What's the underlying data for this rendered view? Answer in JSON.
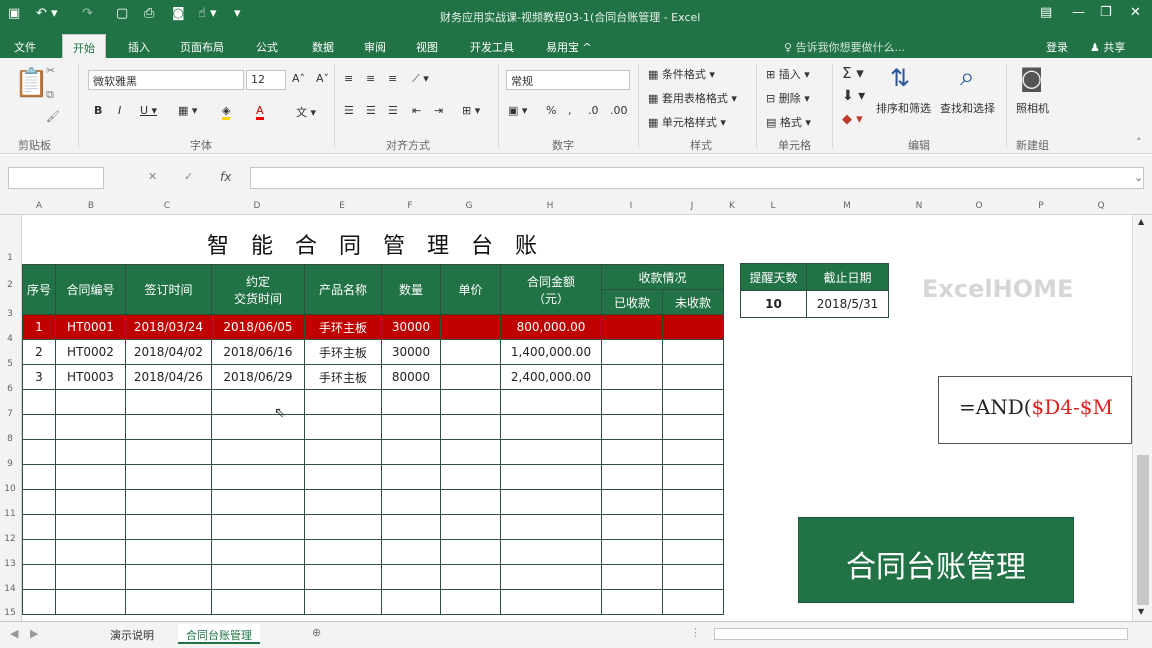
{
  "window": {
    "title": "财务应用实战课-视频教程03-1(合同台账管理 - Excel",
    "quick_access": [
      "save-icon",
      "undo-icon",
      "redo-icon",
      "new-icon",
      "print-preview-icon",
      "camera-icon",
      "touch-icon",
      "customize-icon"
    ],
    "controls": {
      "minimize": "—",
      "restore": "❐",
      "close": "✕"
    }
  },
  "ribbon": {
    "tabs": [
      "文件",
      "开始",
      "插入",
      "页面布局",
      "公式",
      "数据",
      "审阅",
      "视图",
      "开发工具",
      "易用宝 ^"
    ],
    "active_tab": "开始",
    "search_placeholder": "告诉我你想要做什么...",
    "share": "共享",
    "login": "登录",
    "font_name": "微软雅黑",
    "font_size": "12",
    "number_format": "常规",
    "buttons": {
      "cond_format": "条件格式",
      "table_format": "套用表格格式",
      "cell_style": "单元格样式",
      "insert": "插入",
      "delete": "删除",
      "format": "格式",
      "sort_filter": "排序和筛选",
      "find_select": "查找和选择",
      "camera": "照相机"
    },
    "groups": [
      "剪贴板",
      "字体",
      "对齐方式",
      "数字",
      "样式",
      "单元格",
      "编辑",
      "新建组"
    ]
  },
  "formula_bar": {
    "fx": "fx",
    "name_box": "",
    "content": ""
  },
  "columns": [
    "A",
    "B",
    "C",
    "D",
    "E",
    "F",
    "G",
    "H",
    "I",
    "J",
    "K",
    "L",
    "M",
    "N",
    "O",
    "P",
    "Q"
  ],
  "rows": [
    "1",
    "2",
    "3",
    "4",
    "5",
    "6",
    "7",
    "8",
    "9",
    "10",
    "11",
    "12",
    "13",
    "14",
    "15"
  ],
  "sheet": {
    "title": "智能合同管理台账",
    "headers": {
      "seq": "序号",
      "contract_no": "合同编号",
      "sign_date": "签订时间",
      "delivery_top": "约定",
      "delivery_bottom": "交货时间",
      "product": "产品名称",
      "qty": "数量",
      "unit_price": "单价",
      "amount_top": "合同金额",
      "amount_bottom": "（元）",
      "payment": "收款情况",
      "received": "已收款",
      "unreceived": "未收款"
    },
    "data_rows": [
      {
        "seq": "1",
        "no": "HT0001",
        "sign": "2018/03/24",
        "delivery": "2018/06/05",
        "product": "手环主板",
        "qty": "30000",
        "price": "",
        "amount": "800,000.00",
        "received": "",
        "unreceived": ""
      },
      {
        "seq": "2",
        "no": "HT0002",
        "sign": "2018/04/02",
        "delivery": "2018/06/16",
        "product": "手环主板",
        "qty": "30000",
        "price": "",
        "amount": "1,400,000.00",
        "received": "",
        "unreceived": ""
      },
      {
        "seq": "3",
        "no": "HT0003",
        "sign": "2018/04/26",
        "delivery": "2018/06/29",
        "product": "手环主板",
        "qty": "80000",
        "price": "",
        "amount": "2,400,000.00",
        "received": "",
        "unreceived": ""
      }
    ],
    "side": {
      "h1": "提醒天数",
      "h2": "截止日期",
      "v1": "10",
      "v2": "2018/5/31"
    },
    "logo": "ExcelHOME",
    "formula_a": "=AND(",
    "formula_b": "$D4-$M",
    "button": "合同台账管理"
  },
  "sheet_tabs": [
    "演示说明",
    "合同台账管理"
  ],
  "active_sheet": "合同台账管理",
  "colors": {
    "green": "#217346",
    "red": "#c00000"
  }
}
